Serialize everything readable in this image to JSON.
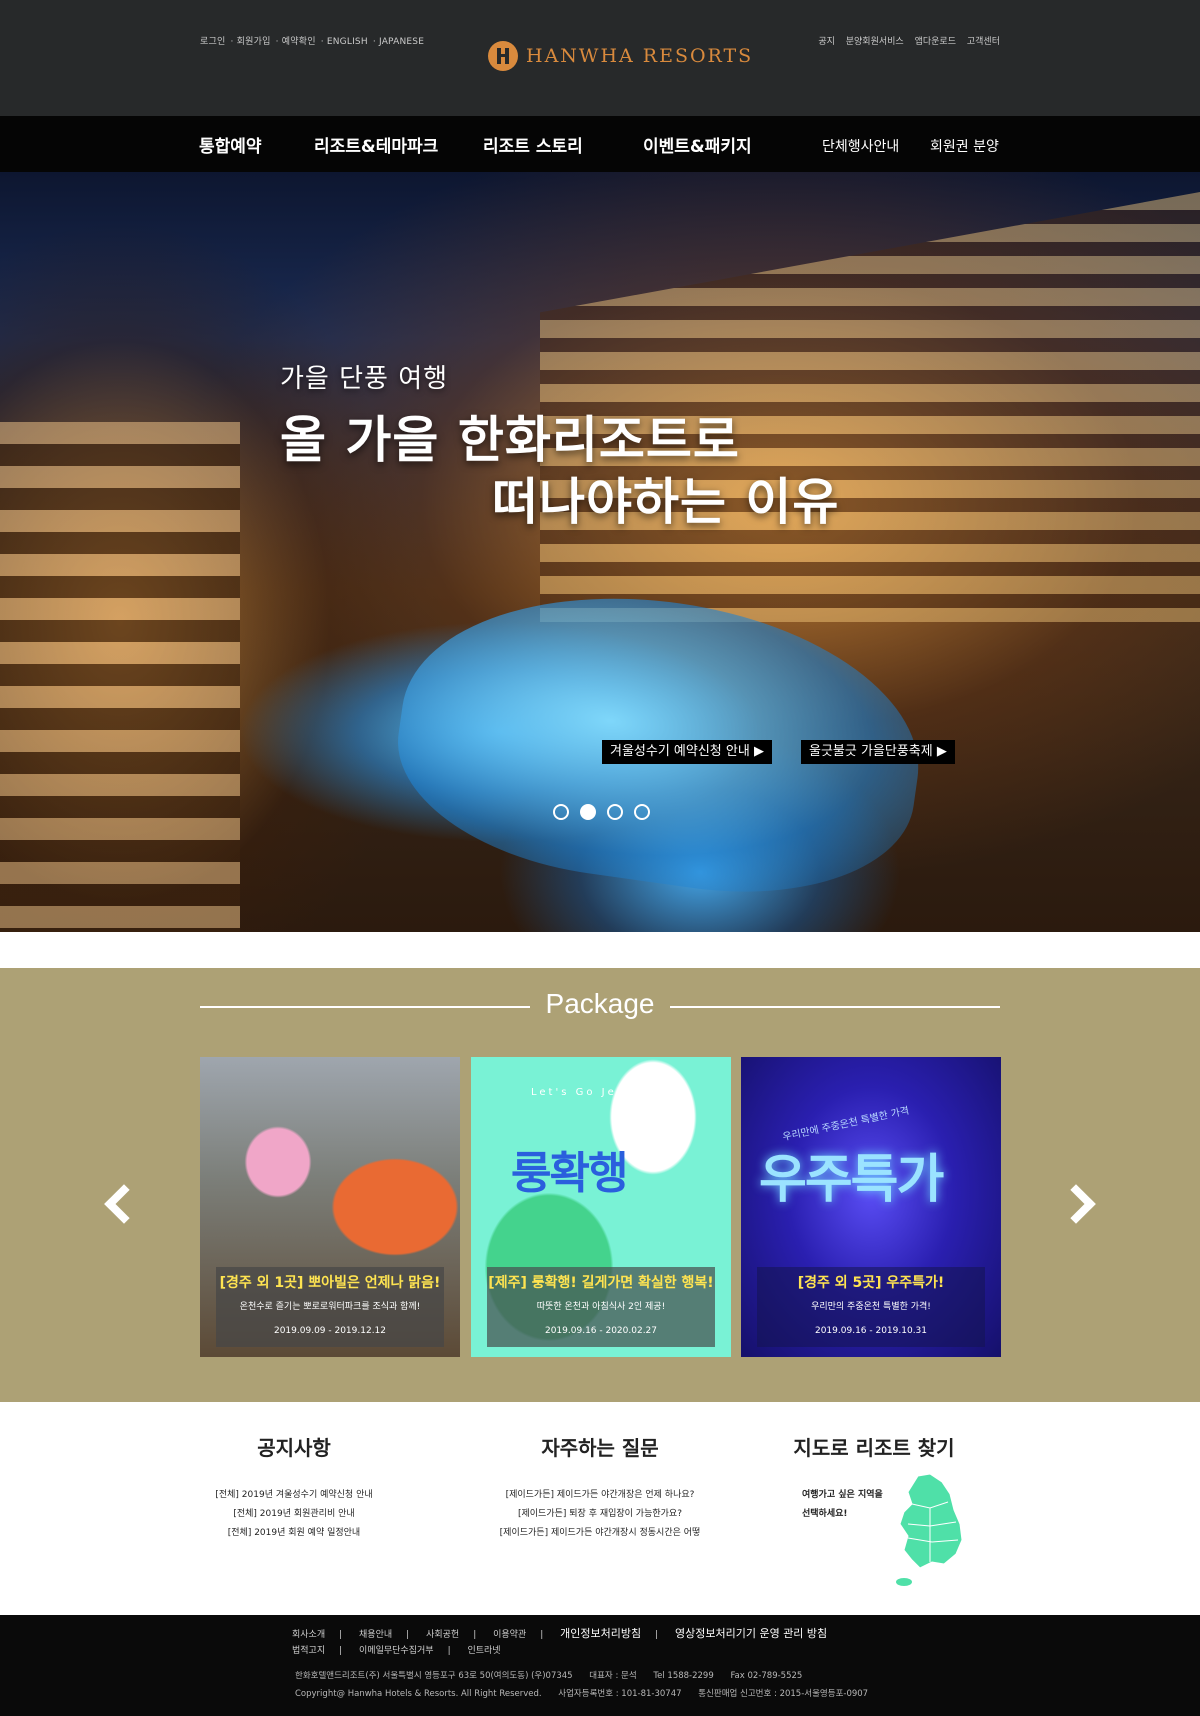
{
  "header": {
    "util_left": [
      "로그인",
      "회원가입",
      "예약확인",
      "ENGLISH",
      "JAPANESE"
    ],
    "util_right": [
      "공지",
      "분양회원서비스",
      "앱다운로드",
      "고객센터"
    ],
    "logo_text": "HANWHA RESORTS",
    "brand_color": "#d98a3d"
  },
  "nav": {
    "items": [
      "통합예약",
      "리조트&테마파크",
      "리조트 스토리",
      "이벤트&패키지"
    ],
    "right_items": [
      "단체행사안내",
      "회원권 분양"
    ]
  },
  "hero": {
    "subtitle": "가을 단풍 여행",
    "title_line1": "올 가을 한화리조트로",
    "title_line2": "떠나야하는 이유",
    "buttons": [
      "겨울성수기 예약신청 안내 ▶",
      "울긋불긋 가을단풍축제 ▶"
    ],
    "slide_count": 4,
    "active_slide": 2
  },
  "package": {
    "title": "Package",
    "bg_color": "#ada175",
    "cards": [
      {
        "title": "[경주 외 1곳] 뽀아빌은 언제나 맑음!",
        "desc": "온천수로 즐기는 뽀로로워터파크를 조식과 함께!",
        "date": "2019.09.09 - 2019.12.12"
      },
      {
        "title": "[제주] 룽확행! 길게가면 확실한 행복!",
        "desc": "따뜻한 온천과 아침식사 2인 제공!",
        "date": "2019.09.16 - 2020.02.27",
        "art_text": "룽확행",
        "art_tag": "Let's Go Jeju"
      },
      {
        "title": "[경주 외 5곳] 우주특가!",
        "desc": "우리만의 주중온천 특별한 가격!",
        "date": "2019.09.16 - 2019.10.31",
        "art_text": "우주특가",
        "art_tag": "우리만에 주중온천 특별한 가격"
      }
    ]
  },
  "notice": {
    "title": "공지사항",
    "items": [
      "[전체] 2019년 겨울성수기 예약신청 안내",
      "[전체] 2019년 회원관리비 안내",
      "[전체] 2019년 회원 예약 일정안내"
    ]
  },
  "faq": {
    "title": "자주하는 질문",
    "items": [
      "[제이드가든] 제이드가든 야간개장은 언제 하나요?",
      "[제이드가든] 퇴장 후 재입장이 가능한가요?",
      "[제이드가든] 제이드가든 야간개장시 정동시간은 어떻"
    ]
  },
  "map": {
    "title": "지도로 리조트 찾기",
    "text_line1": "여행가고 싶은 지역을",
    "text_line2": "선택하세요!",
    "map_color": "#4fe0a8"
  },
  "footer": {
    "links_row1": [
      "회사소개",
      "채용안내",
      "사회공헌",
      "이용약관"
    ],
    "links_row1_strong": [
      "개인정보처리방침",
      "영상정보처리기기 운영 관리 방침"
    ],
    "links_row2": [
      "법적고지",
      "이메일무단수집거부",
      "인트라넷"
    ],
    "info_row1": [
      "한화호텔앤드리조트(주) 서울특별시 영등포구 63로 50(여의도동) (우)07345",
      "대표자 : 문석",
      "Tel 1588-2299",
      "Fax 02-789-5525"
    ],
    "info_row2": [
      "Copyright@ Hanwha Hotels & Resorts. All Right Reserved.",
      "사업자등록번호 : 101-81-30747",
      "통신판매업 신고번호 : 2015-서울영등포-0907"
    ]
  }
}
